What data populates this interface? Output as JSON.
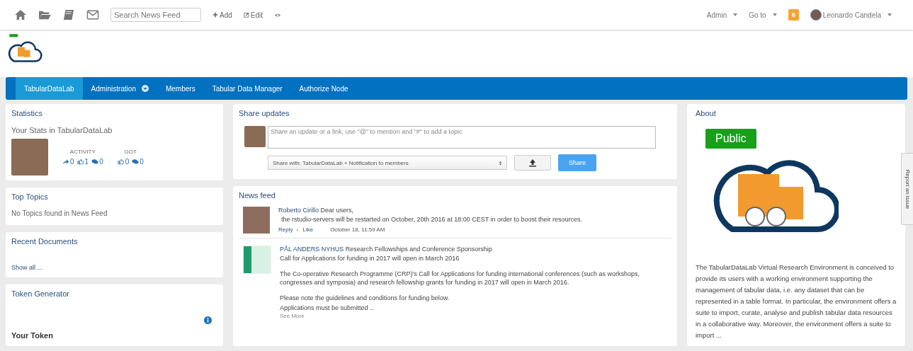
{
  "topbar": {
    "search": {
      "placeholder": "Search News Feed"
    },
    "actions": [
      {
        "kind": "add",
        "label": "Add"
      },
      {
        "kind": "edit",
        "label": "Edit"
      }
    ],
    "menus": [
      {
        "label": "Admin"
      },
      {
        "label": "Go to"
      }
    ],
    "notifications": "6",
    "user": "Leonardo Candela"
  },
  "nav": [
    {
      "label": "TabularDataLab",
      "selected": true,
      "has_menu": false
    },
    {
      "label": "Administration",
      "selected": false,
      "has_menu": true
    },
    {
      "label": "Members",
      "selected": false,
      "has_menu": false
    },
    {
      "label": "Tabular Data Manager",
      "selected": false,
      "has_menu": false
    },
    {
      "label": "Authorize Node",
      "selected": false,
      "has_menu": false
    }
  ],
  "statistics": {
    "title": "Statistics",
    "subtitle": "Your Stats in TabularDataLab",
    "groups": [
      {
        "label": "ACTIVITY",
        "counts": [
          {
            "kind": "share",
            "value": "0"
          },
          {
            "kind": "like",
            "value": "1"
          },
          {
            "kind": "comment",
            "value": "0"
          }
        ]
      },
      {
        "label": "GOT",
        "counts": [
          {
            "kind": "like",
            "value": "0"
          },
          {
            "kind": "comment",
            "value": "0"
          }
        ]
      }
    ]
  },
  "top_topics": {
    "title": "Top Topics",
    "text": "No Topics found in News Feed"
  },
  "recent_documents": {
    "title": "Recent Documents",
    "link": "Show all ..."
  },
  "token_generator": {
    "title": "Token Generator",
    "subtitle": "Your Token"
  },
  "share_updates": {
    "title": "Share updates",
    "placeholder": "Share an update or a link, use \"@\" to mention and \"#\" to add a topic",
    "share_with": "Share with: TabularDataLab + Notification to members",
    "button": "Share"
  },
  "news_feed": {
    "title": "News feed",
    "posts": [
      {
        "author": "Roberto Cirillo",
        "headline": "Dear users,",
        "lines": [
          "the rstudio-servers will be restarted on October, 20th 2016 at 18:00 CEST in order to boost their resources."
        ],
        "actions": [
          "Reply",
          "Like"
        ],
        "time": "October 18, 11:59 AM"
      },
      {
        "author": "PÅL ANDERS NYHUS",
        "headline": "Research Fellowships and Conference Sponsorship",
        "lines": [
          "Call for Applications for funding in 2017 will open in March 2016",
          "The Co-operative Research Programme (CRP)'s Call for Applications for funding international conferences (such as workshops, congresses and symposia) and research fellowship grants for funding in 2017 will open in March 2016.",
          "Please note the guidelines and conditions for funding below.",
          "Applications must be submitted .."
        ],
        "more": "See More"
      }
    ]
  },
  "about": {
    "title": "About",
    "badge": "Public",
    "text": "The TabularDataLab Virtual Research Environment is conceived to provide its users with a working environment supporting the management of tabular data, i.e. any dataset that can be represented in a table format. In particular, the environment offers a suite to import, curate, analyse and publish tabular data resources in a collaborative way. Moreover, the environment offers a suite to import ..."
  },
  "report_tab": "Report an issue"
}
